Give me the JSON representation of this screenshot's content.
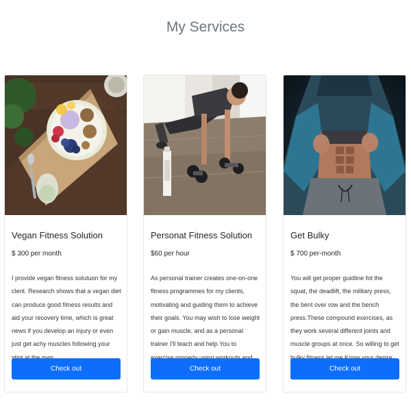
{
  "page": {
    "title": "My Services"
  },
  "cards": [
    {
      "image": "vegan-food-bowl-image",
      "title": "Vegan Fitness Solution",
      "price": "$ 300 per month",
      "text": "I provide vegan fitness solutuon for my clent. Research shows that a vegan diet can produce good fitness results and aid your recovery time, which is great news if you develop an injury or even just get achy muscles following your stint at the gym.",
      "button": "Check out"
    },
    {
      "image": "pushup-dumbbells-image",
      "title": "Personat Fitness Solution",
      "price": "$60 per hour",
      "text": "As personal trainer creates one-on-one fitness programmes for my clients, motivating and guiding them to achieve their goals. You may wish to lose weight or gain muscle, and as a personal trainer I'll teach and help You to exercise properly using workouts and specific plans.",
      "button": "Check out"
    },
    {
      "image": "muscular-abs-hoodie-image",
      "title": "Get Bulky",
      "price": "$ 700 per-month",
      "text": "You will get proper guidline fot the squat, the deadlift, the military press, the bent over row and the bench press.These compound exercises, as they work several different joints and muscle groups at once. So willing to get bulky fitness,let me Know your desire about our choice.",
      "button": "Check out"
    }
  ],
  "colors": {
    "primary": "#0d6efd",
    "title": "#6c757d"
  }
}
